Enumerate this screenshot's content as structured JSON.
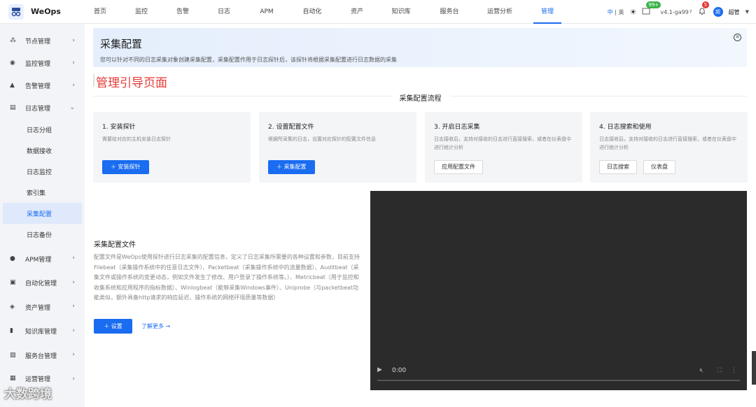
{
  "app": {
    "name": "WeOps"
  },
  "nav": {
    "items": [
      "首页",
      "监控",
      "告警",
      "日志",
      "APM",
      "自动化",
      "资产",
      "知识库",
      "服务台",
      "运营分析",
      "管理"
    ],
    "active": "管理"
  },
  "topright": {
    "lang_cn": "中",
    "lang_sep": "|",
    "lang_en": "英",
    "msg_badge": "99+",
    "version": "v4.1-ga99",
    "bell_badge": "5",
    "avatar_text": "超",
    "user": "超管"
  },
  "sidebar": {
    "items": [
      {
        "label": "节点管理",
        "icon": "node-icon",
        "arrow": "›"
      },
      {
        "label": "监控管理",
        "icon": "monitor-icon",
        "arrow": "›"
      },
      {
        "label": "告警管理",
        "icon": "alarm-icon",
        "arrow": "›"
      },
      {
        "label": "日志管理",
        "icon": "log-icon",
        "arrow": "⌄"
      }
    ],
    "log_sub": [
      "日志分组",
      "数据接收",
      "日志监控",
      "索引集",
      "采集配置",
      "日志备份"
    ],
    "active_sub": "采集配置",
    "items_after": [
      {
        "label": "APM管理",
        "icon": "apm-icon",
        "arrow": "›"
      },
      {
        "label": "自动化管理",
        "icon": "automation-icon",
        "arrow": "›"
      },
      {
        "label": "资产管理",
        "icon": "asset-icon",
        "arrow": "›"
      },
      {
        "label": "知识库管理",
        "icon": "knowledge-icon",
        "arrow": "›"
      },
      {
        "label": "服务台管理",
        "icon": "service-desk-icon",
        "arrow": "›"
      },
      {
        "label": "运营管理",
        "icon": "operation-icon",
        "arrow": "›"
      }
    ]
  },
  "banner": {
    "title": "采集配置",
    "desc": "您可以针对不同的日志采集对象创建采集配置，采集配置作用于日志探针后，该探针将根据采集配置进行日志数据的采集"
  },
  "guide": {
    "title": "管理引导页面",
    "flow_title": "采集配置流程"
  },
  "cards": [
    {
      "title": "1. 安装探针",
      "desc": "需要给对应的主机安装日志探针",
      "buttons": [
        "＋ 安装探针"
      ]
    },
    {
      "title": "2. 设置配置文件",
      "desc": "根据所采集的日志，设置对应探针的配置文件信息",
      "buttons": [
        "＋ 采集配置"
      ]
    },
    {
      "title": "3. 开启日志采集",
      "desc": "日志接收后，支持对接收的日志进行直接搜索，或者在仪表盘中进行统计分析",
      "buttons": [
        "应用配置文件"
      ]
    },
    {
      "title": "4. 日志搜索和使用",
      "desc": "日志接收后，支持对接收的日志进行直接搜索，或者在仪表盘中进行统计分析",
      "buttons": [
        "日志搜索",
        "仪表盘"
      ]
    }
  ],
  "section": {
    "title": "采集配置文件",
    "desc": "配置文件是WeOps使用探针进行日志采集的配置信息，定义了日志采集所需要的各种设置和参数，目前支持Filebeat（采集操作系统中的任意日志文件）、Packetbeat（采集操作系统中的流量数据）、Auditbeat（采集文件或操作系统的变更动态，例如文件发生了修改、用户登录了操作系统等。）、Metricbeat（用于监控和收集系统和应用程序的指标数据）、Winlogbeat（能够采集Windows事件）、Uniprobe（与packetbeat功能类似，额外具备http请求的响应延迟、操作系统的网络环境质量等数据）",
    "set_button": "＋ 设置",
    "learn_more": "了解更多 →"
  },
  "video": {
    "time": "0:00",
    "progress": 0
  },
  "watermark": "大数跨境"
}
